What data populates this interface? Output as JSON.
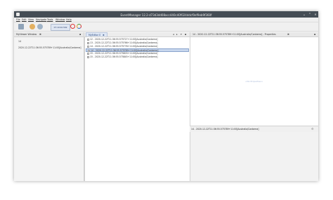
{
  "window": {
    "title": "EventManager 12.2-d73d3dd08acc440c40f024ddcf0ef9eb9f360f",
    "minimize_glyph": "⌄",
    "maximize_glyph": "⌃",
    "close_glyph": "✕"
  },
  "menu": [
    {
      "label": "File"
    },
    {
      "label": "Edit"
    },
    {
      "label": "View"
    },
    {
      "label": "Navigate"
    },
    {
      "label": "Tools"
    },
    {
      "label": "Window"
    },
    {
      "label": "Help"
    }
  ],
  "toolbar": {
    "time_value": "07:19:02.569"
  },
  "left_panel": {
    "title": "MyViewer Window",
    "close_glyph": "✖",
    "menu_glyph": "▪",
    "lines": [
      "14",
      "2020-12-22T11:36:55.575789+11:00[Australia/Canberra]"
    ]
  },
  "center_panel": {
    "tab_label": "MyEditor 0",
    "tab_close": "✖",
    "nav_glyphs": [
      "◂",
      "▸",
      "▾",
      "▪"
    ],
    "rows": [
      {
        "text": "12 - 2020-12-22T11:36:55.575727+11:00[Australia/Canberra]"
      },
      {
        "text": "13 - 2020-12-22T11:36:55.575766+11:00[Australia/Canberra]"
      },
      {
        "text": "14 - 2020-12-22T11:36:55.575778+11:00[Australia/Canberra]"
      },
      {
        "text": "14 - 2020-12-22T11:36:55.575789+11:00[Australia/Canberra]"
      },
      {
        "text": "15 - 2020-12-22T11:36:55.575803+11:00[Australia/Canberra]"
      },
      {
        "text": "15 - 2020-12-22T11:36:55.575845+11:00[Australia/Canberra]"
      }
    ],
    "selected_index": 3
  },
  "properties_panel": {
    "title": "14 - 2020-12-22T11:36:55.575789+11:00[Australia/Canberra] - Properties",
    "close_glyph": "✖",
    "menu_glyph": "▪",
    "placeholder": "<No Properties>"
  },
  "lower_right": {
    "title": "14 - 2020-12-22T11:36:55.575789+11:00[Australia/Canberra]",
    "info_glyph": "⚙"
  },
  "colors": {
    "titlebar": "#454d55",
    "selection": "#c8d7ee",
    "accent_red": "#dd3333",
    "tab_blue": "#dfe8f6"
  }
}
